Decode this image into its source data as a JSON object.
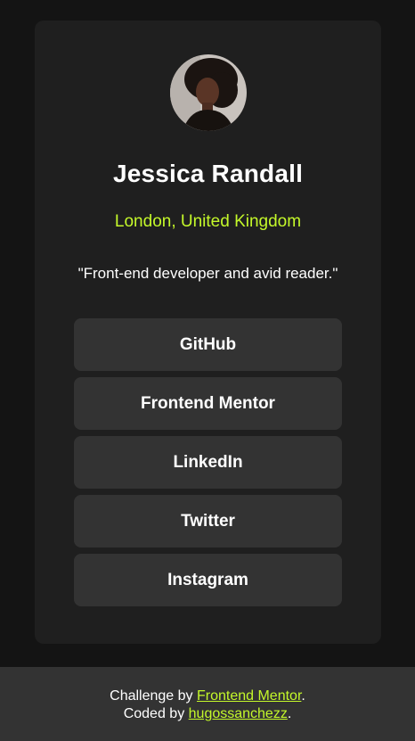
{
  "profile": {
    "name": "Jessica Randall",
    "location": "London, United Kingdom",
    "bio": "\"Front-end developer and avid reader.\""
  },
  "links": [
    {
      "label": "GitHub"
    },
    {
      "label": "Frontend Mentor"
    },
    {
      "label": "LinkedIn"
    },
    {
      "label": "Twitter"
    },
    {
      "label": "Instagram"
    }
  ],
  "footer": {
    "challenge_prefix": "Challenge by ",
    "challenge_link": "Frontend Mentor",
    "challenge_suffix": ".",
    "coded_prefix": "Coded by ",
    "coded_link": "hugossanchezz",
    "coded_suffix": "."
  },
  "colors": {
    "background": "#141414",
    "card": "#1f1f1f",
    "button": "#333333",
    "accent": "#c4f82a"
  }
}
